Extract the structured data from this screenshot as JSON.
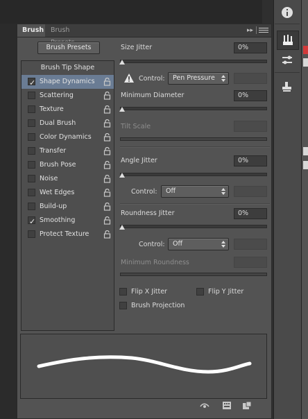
{
  "tabs": {
    "brush": "Brush",
    "brush_presets": "Brush Presets"
  },
  "panel_menu_icon": "double-chevron-right-icon",
  "presets_button": "Brush Presets",
  "list": {
    "header": "Brush Tip Shape",
    "items": [
      {
        "label": "Shape Dynamics",
        "checked": true,
        "selected": true
      },
      {
        "label": "Scattering",
        "checked": false
      },
      {
        "label": "Texture",
        "checked": false
      },
      {
        "label": "Dual Brush",
        "checked": false
      },
      {
        "label": "Color Dynamics",
        "checked": false
      },
      {
        "label": "Transfer",
        "checked": false
      },
      {
        "label": "Brush Pose",
        "checked": false
      },
      {
        "label": "Noise",
        "checked": false
      },
      {
        "label": "Wet Edges",
        "checked": false
      },
      {
        "label": "Build-up",
        "checked": false
      },
      {
        "label": "Smoothing",
        "checked": true
      },
      {
        "label": "Protect Texture",
        "checked": false
      }
    ]
  },
  "settings": {
    "size_jitter": {
      "label": "Size Jitter",
      "value": "0%"
    },
    "control_1": {
      "label": "Control:",
      "value": "Pen Pressure"
    },
    "minimum_diameter": {
      "label": "Minimum Diameter",
      "value": "0%"
    },
    "tilt_scale": {
      "label": "Tilt Scale",
      "value": ""
    },
    "angle_jitter": {
      "label": "Angle Jitter",
      "value": "0%"
    },
    "control_2": {
      "label": "Control:",
      "value": "Off"
    },
    "roundness_jitter": {
      "label": "Roundness Jitter",
      "value": "0%"
    },
    "control_3": {
      "label": "Control:",
      "value": "Off"
    },
    "minimum_roundness": {
      "label": "Minimum Roundness",
      "value": ""
    },
    "flip_x": "Flip X Jitter",
    "flip_y": "Flip Y Jitter",
    "brush_projection": "Brush Projection"
  },
  "colors": {
    "selected_row": "#6a7c94",
    "panel": "#535353",
    "stroke": "#ffffff"
  }
}
